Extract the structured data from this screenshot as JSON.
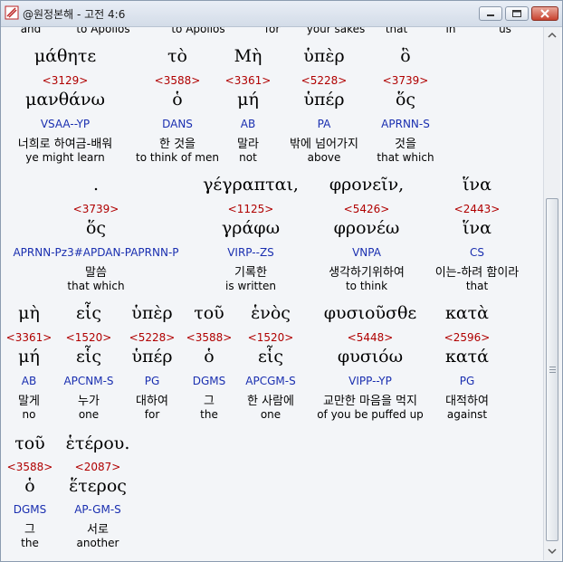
{
  "window": {
    "title": "@원정본해 - 고전 4:6",
    "buttons": {
      "minimize": "minimize",
      "maximize": "maximize",
      "close": "close"
    }
  },
  "top_partial": [
    "and",
    "to Apollos",
    "to Apollos",
    "for",
    "your sakes",
    "that",
    "in",
    "us"
  ],
  "rows": [
    {
      "words": [
        {
          "greek": "μάθητε",
          "strong": "<3129>",
          "lemma": "μανθάνω",
          "morph": "VSAA--YP",
          "korean": "너희로 하여금-배워",
          "english": "ye might learn"
        },
        {
          "greek": "τὸ",
          "strong": "<3588>",
          "lemma": "ὁ",
          "morph": "DANS",
          "korean": "한 것을",
          "english": "to think of men"
        },
        {
          "greek": "Μὴ",
          "strong": "<3361>",
          "lemma": "μή",
          "morph": "AB",
          "korean": "말라",
          "english": "not"
        },
        {
          "greek": "ὑπὲρ",
          "strong": "<5228>",
          "lemma": "ὑπέρ",
          "morph": "PA",
          "korean": "밖에 넘어가지",
          "english": "above"
        },
        {
          "greek": "ὃ",
          "strong": "<3739>",
          "lemma": "ὅς",
          "morph": "APRNN-S",
          "korean": "것을",
          "english": "that which"
        }
      ]
    },
    {
      "words": [
        {
          "greek": ".",
          "strong": "<3739>",
          "lemma": "ὅς",
          "morph": "APRNN-Pz3#APDAN-PAPRNN-P",
          "korean": "말씀",
          "english": "that which"
        },
        {
          "greek": "γέγραπται,",
          "strong": "<1125>",
          "lemma": "γράφω",
          "morph": "VIRP--ZS",
          "korean": "기록한",
          "english": "is written"
        },
        {
          "greek": "φρονεῖν,",
          "strong": "<5426>",
          "lemma": "φρονέω",
          "morph": "VNPA",
          "korean": "생각하기위하여",
          "english": "to think"
        },
        {
          "greek": "ἵνα",
          "strong": "<2443>",
          "lemma": "ἵνα",
          "morph": "CS",
          "korean": "이는-하려 함이라",
          "english": "that"
        }
      ]
    },
    {
      "words": [
        {
          "greek": "μὴ",
          "strong": "<3361>",
          "lemma": "μή",
          "morph": "AB",
          "korean": "말게",
          "english": "no"
        },
        {
          "greek": "εἷς",
          "strong": "<1520>",
          "lemma": "εἷς",
          "morph": "APCNM-S",
          "korean": "누가",
          "english": "one"
        },
        {
          "greek": "ὑπὲρ",
          "strong": "<5228>",
          "lemma": "ὑπέρ",
          "morph": "PG",
          "korean": "대하여",
          "english": "for"
        },
        {
          "greek": "τοῦ",
          "strong": "<3588>",
          "lemma": "ὁ",
          "morph": "DGMS",
          "korean": "그",
          "english": "the"
        },
        {
          "greek": "ἑνὸς",
          "strong": "<1520>",
          "lemma": "εἷς",
          "morph": "APCGM-S",
          "korean": "한 사람에",
          "english": "one"
        },
        {
          "greek": "φυσιοῦσθε",
          "strong": "<5448>",
          "lemma": "φυσιόω",
          "morph": "VIPP--YP",
          "korean": "교만한 마음을 먹지",
          "english": "of you be puffed up"
        },
        {
          "greek": "κατὰ",
          "strong": "<2596>",
          "lemma": "κατά",
          "morph": "PG",
          "korean": "대적하여",
          "english": "against"
        }
      ]
    },
    {
      "words": [
        {
          "greek": "τοῦ",
          "strong": "<3588>",
          "lemma": "ὁ",
          "morph": "DGMS",
          "korean": "그",
          "english": "the"
        },
        {
          "greek": "ἑτέρου.",
          "strong": "<2087>",
          "lemma": "ἕτερος",
          "morph": "AP-GM-S",
          "korean": "서로",
          "english": "another"
        }
      ]
    }
  ]
}
